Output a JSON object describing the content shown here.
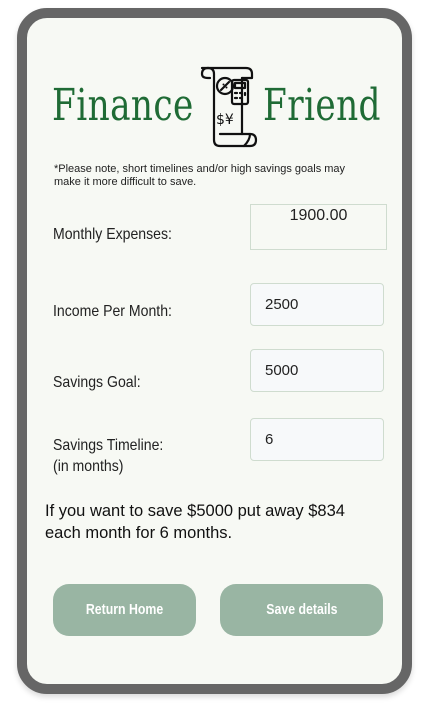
{
  "header": {
    "title_left": "Finance",
    "title_right": "Friend",
    "logo_icon": "receipt-calculator-icon",
    "accent_color": "#1f6b35"
  },
  "note": "*Please note, short timelines and/or high savings goals may make it more difficult to save.",
  "form": {
    "monthly_expenses": {
      "label": "Monthly Expenses:",
      "value": "1900.00"
    },
    "income": {
      "label": "Income Per Month:",
      "value": "2500"
    },
    "savings_goal": {
      "label": "Savings Goal:",
      "value": "5000"
    },
    "timeline": {
      "label_line1": "Savings Timeline:",
      "label_line2": "(in months)",
      "value": "6"
    }
  },
  "result": "If you want to save $5000 put away $834 each month for 6 months.",
  "buttons": {
    "home": "Return Home",
    "save": "Save details",
    "color": "#99b5a3"
  }
}
